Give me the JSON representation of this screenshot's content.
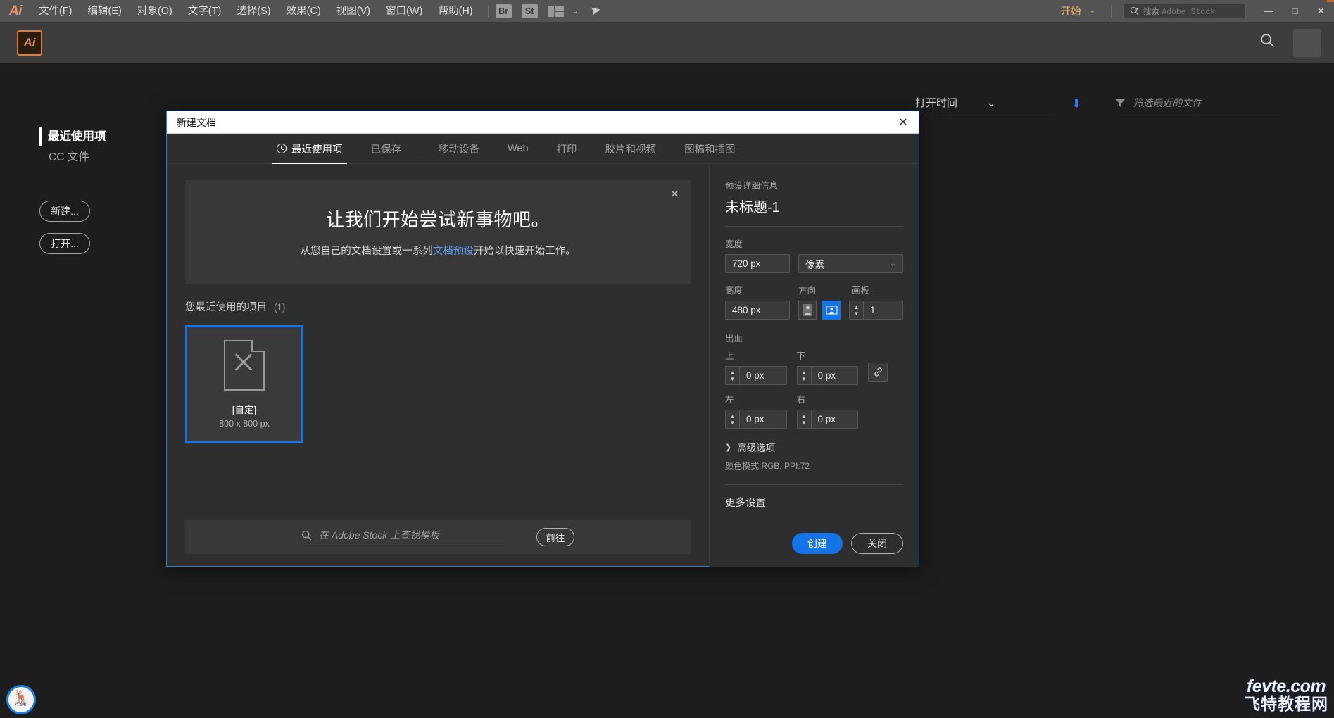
{
  "app": {
    "logo": "Ai",
    "menus": [
      {
        "label": "文件(F)"
      },
      {
        "label": "编辑(E)"
      },
      {
        "label": "对象(O)"
      },
      {
        "label": "文字(T)"
      },
      {
        "label": "选择(S)"
      },
      {
        "label": "效果(C)"
      },
      {
        "label": "视图(V)"
      },
      {
        "label": "窗口(W)"
      },
      {
        "label": "帮助(H)"
      }
    ],
    "bridge_badge": "Br",
    "stock_badge": "St",
    "start_label": "开始",
    "stock_search_prefix": "搜索",
    "stock_search_brand": "Adobe Stock",
    "window_minimize": "—",
    "window_maximize": "□",
    "window_close": "✕"
  },
  "home": {
    "logo": "Ai",
    "sidebar": {
      "recent_label": "最近使用项",
      "cc_label": "CC 文件",
      "new_button": "新建...",
      "open_button": "打开..."
    },
    "recent_bar": {
      "sort_label": "打开时间",
      "filter_placeholder": "筛选最近的文件"
    },
    "deer_logo_text": "行走者",
    "watermark_line1": "fevte.com",
    "watermark_line2": "飞特教程网"
  },
  "dialog": {
    "title": "新建文档",
    "close_label": "✕",
    "tabs": [
      {
        "label": "最近使用项",
        "icon": "clock-icon",
        "active": true
      },
      {
        "label": "已保存",
        "active": false
      },
      {
        "label": "移动设备",
        "active": false
      },
      {
        "label": "Web",
        "active": false
      },
      {
        "label": "打印",
        "active": false
      },
      {
        "label": "胶片和视频",
        "active": false
      },
      {
        "label": "图稿和插图",
        "active": false
      }
    ],
    "banner": {
      "headline": "让我们开始尝试新事物吧。",
      "sub_before": "从您自己的文档设置或一系列",
      "sub_link": "文档预设",
      "sub_after": "开始以快速开始工作。",
      "close_label": "✕"
    },
    "recent": {
      "heading": "您最近使用的项目",
      "count": "(1)",
      "items": [
        {
          "name": "[自定]",
          "size": "800 x 800 px"
        }
      ]
    },
    "stock": {
      "placeholder": "在 Adobe Stock 上查找模板",
      "go_label": "前往"
    },
    "preset": {
      "section_label": "预设详细信息",
      "name": "未标题-1",
      "width_label": "宽度",
      "width_value": "720 px",
      "unit_value": "像素",
      "height_label": "高度",
      "height_value": "480 px",
      "orientation_label": "方向",
      "artboards_label": "画板",
      "artboards_value": "1",
      "bleed_label": "出血",
      "bleed_top_label": "上",
      "bleed_top_value": "0 px",
      "bleed_bottom_label": "下",
      "bleed_bottom_value": "0 px",
      "bleed_left_label": "左",
      "bleed_left_value": "0 px",
      "bleed_right_label": "右",
      "bleed_right_value": "0 px",
      "advanced_label": "高级选项",
      "color_mode_info": "颜色模式:RGB, PPI:72",
      "more_settings": "更多设置"
    },
    "actions": {
      "create": "创建",
      "close": "关闭"
    }
  }
}
